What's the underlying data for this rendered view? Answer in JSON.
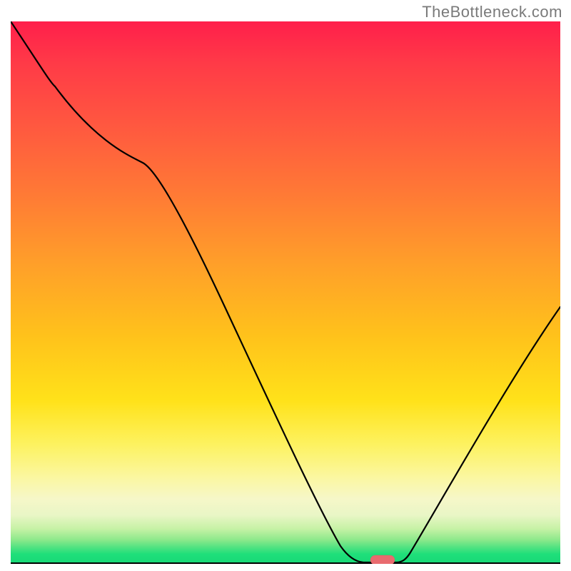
{
  "watermark": "TheBottleneck.com",
  "colors": {
    "gradient_top": "#ff1f4b",
    "gradient_mid_orange": "#ffa029",
    "gradient_yellow": "#ffe21a",
    "gradient_pale": "#f6f7c8",
    "gradient_green": "#17d877",
    "curve": "#000000",
    "marker": "#e86b6f"
  },
  "chart_data": {
    "type": "line",
    "title": "",
    "xlabel": "",
    "ylabel": "",
    "xlim": [
      0,
      100
    ],
    "ylim": [
      0,
      100
    ],
    "x": [
      0,
      8,
      24,
      60,
      64,
      70,
      72,
      100
    ],
    "values": [
      100,
      88,
      74,
      7,
      0,
      0,
      1,
      47
    ],
    "marker": {
      "x": 67,
      "y": 0,
      "shape": "rounded-rect"
    },
    "notes": "Background is a vertical gradient: y≈100 is red, mid is orange→yellow, y≈0 is a thin green band. Curve is a black V reaching the baseline near x≈64–70. A small salmon pill marks the minimum on the baseline. Values are estimated from pixel positions; the plot has no numeric axis ticks.",
    "legend": [],
    "grid": false
  }
}
